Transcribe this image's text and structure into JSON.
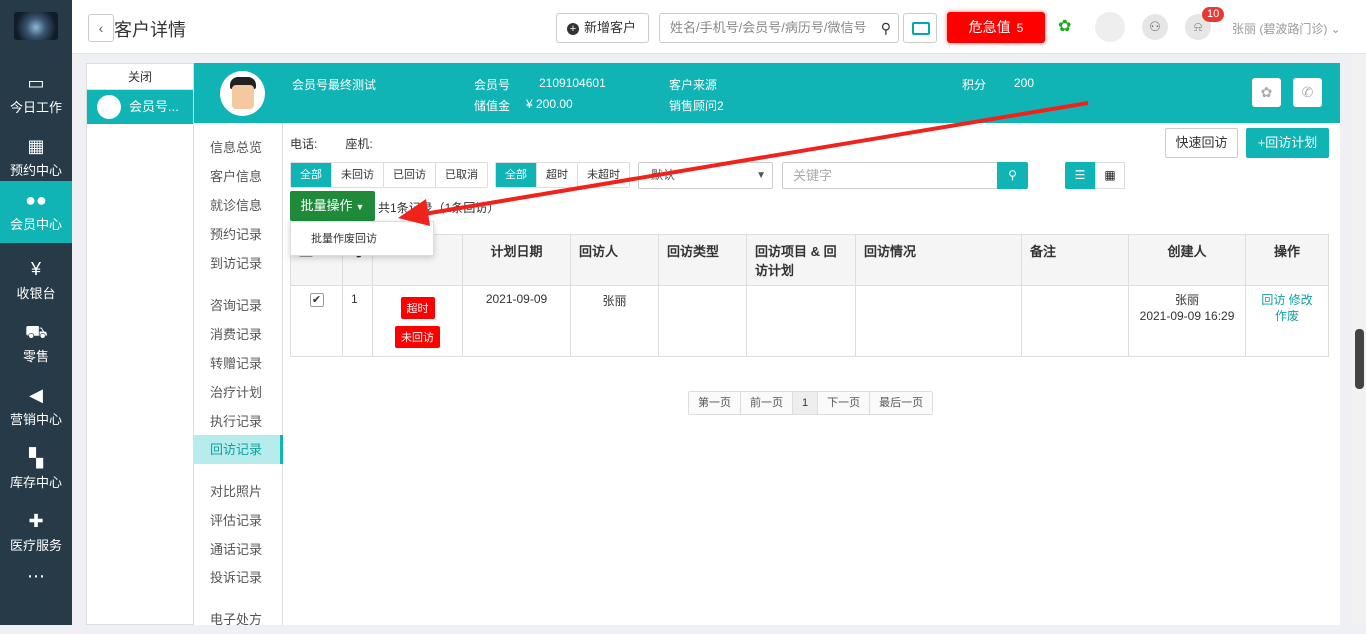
{
  "nav": {
    "items": [
      {
        "label": "今日工作",
        "icon": "laptop-icon"
      },
      {
        "label": "预约中心",
        "icon": "calendar-icon"
      },
      {
        "label": "会员中心",
        "icon": "users-icon"
      },
      {
        "label": "收银台",
        "icon": "yen-icon"
      },
      {
        "label": "零售",
        "icon": "cart-icon"
      },
      {
        "label": "营销中心",
        "icon": "megaphone-icon"
      },
      {
        "label": "库存中心",
        "icon": "grid-icon"
      },
      {
        "label": "医疗服务",
        "icon": "medkit-icon"
      }
    ],
    "active_index": 2
  },
  "topbar": {
    "title": "客户详情",
    "new_customer": "新增客户",
    "search_placeholder": "姓名/手机号/会员号/病历号/微信号",
    "danger_label": "危急值",
    "danger_count": "5",
    "notice_count": "10",
    "user": "张丽 (碧波路门诊)"
  },
  "tabs": {
    "close": "关闭",
    "customer_tab": "会员号..."
  },
  "customer": {
    "name": "会员号最终测试",
    "member_no_label": "会员号",
    "member_no": "2109104601",
    "stored_label": "储值金",
    "stored_value": "¥ 200.00",
    "source_label": "客户来源",
    "consultant": "销售顾问2",
    "points_label": "积分",
    "points": "200"
  },
  "submenu": [
    "信息总览",
    "客户信息",
    "就诊信息",
    "预约记录",
    "到访记录",
    "咨询记录",
    "消费记录",
    "转赠记录",
    "治疗计划",
    "执行记录",
    "回访记录",
    "对比照片",
    "评估记录",
    "通话记录",
    "投诉记录",
    "电子处方"
  ],
  "content": {
    "phone_label": "电话:",
    "landline_label": "座机:",
    "quick_visit": "快速回访",
    "add_plan": "+回访计划",
    "status_filters": [
      "全部",
      "未回访",
      "已回访",
      "已取消"
    ],
    "time_filters": [
      "全部",
      "超时",
      "未超时"
    ],
    "sort_selected": "默认",
    "keyword_placeholder": "关键字",
    "batch_label": "批量操作",
    "total_text": "共1条记录（1条回访）",
    "batch_menu_item": "批量作废回访"
  },
  "table": {
    "headers": [
      "",
      "号",
      "",
      "计划日期",
      "回访人",
      "回访类型",
      "回访项目 & 回访计划",
      "回访情况",
      "备注",
      "创建人",
      "操作"
    ],
    "rows": [
      {
        "no": "1",
        "tag1": "超时",
        "tag2": "未回访",
        "date": "2021-09-09",
        "visitor": "张丽",
        "creator": "张丽",
        "created_at": "2021-09-09 16:29",
        "ops": [
          "回访",
          "修改",
          "作废"
        ]
      }
    ]
  },
  "pager": [
    "第一页",
    "前一页",
    "1",
    "下一页",
    "最后一页"
  ],
  "colors": {
    "accent": "#11b4b4",
    "nav": "#263a47",
    "danger": "#ff0000",
    "batch": "#1f8a3a"
  }
}
